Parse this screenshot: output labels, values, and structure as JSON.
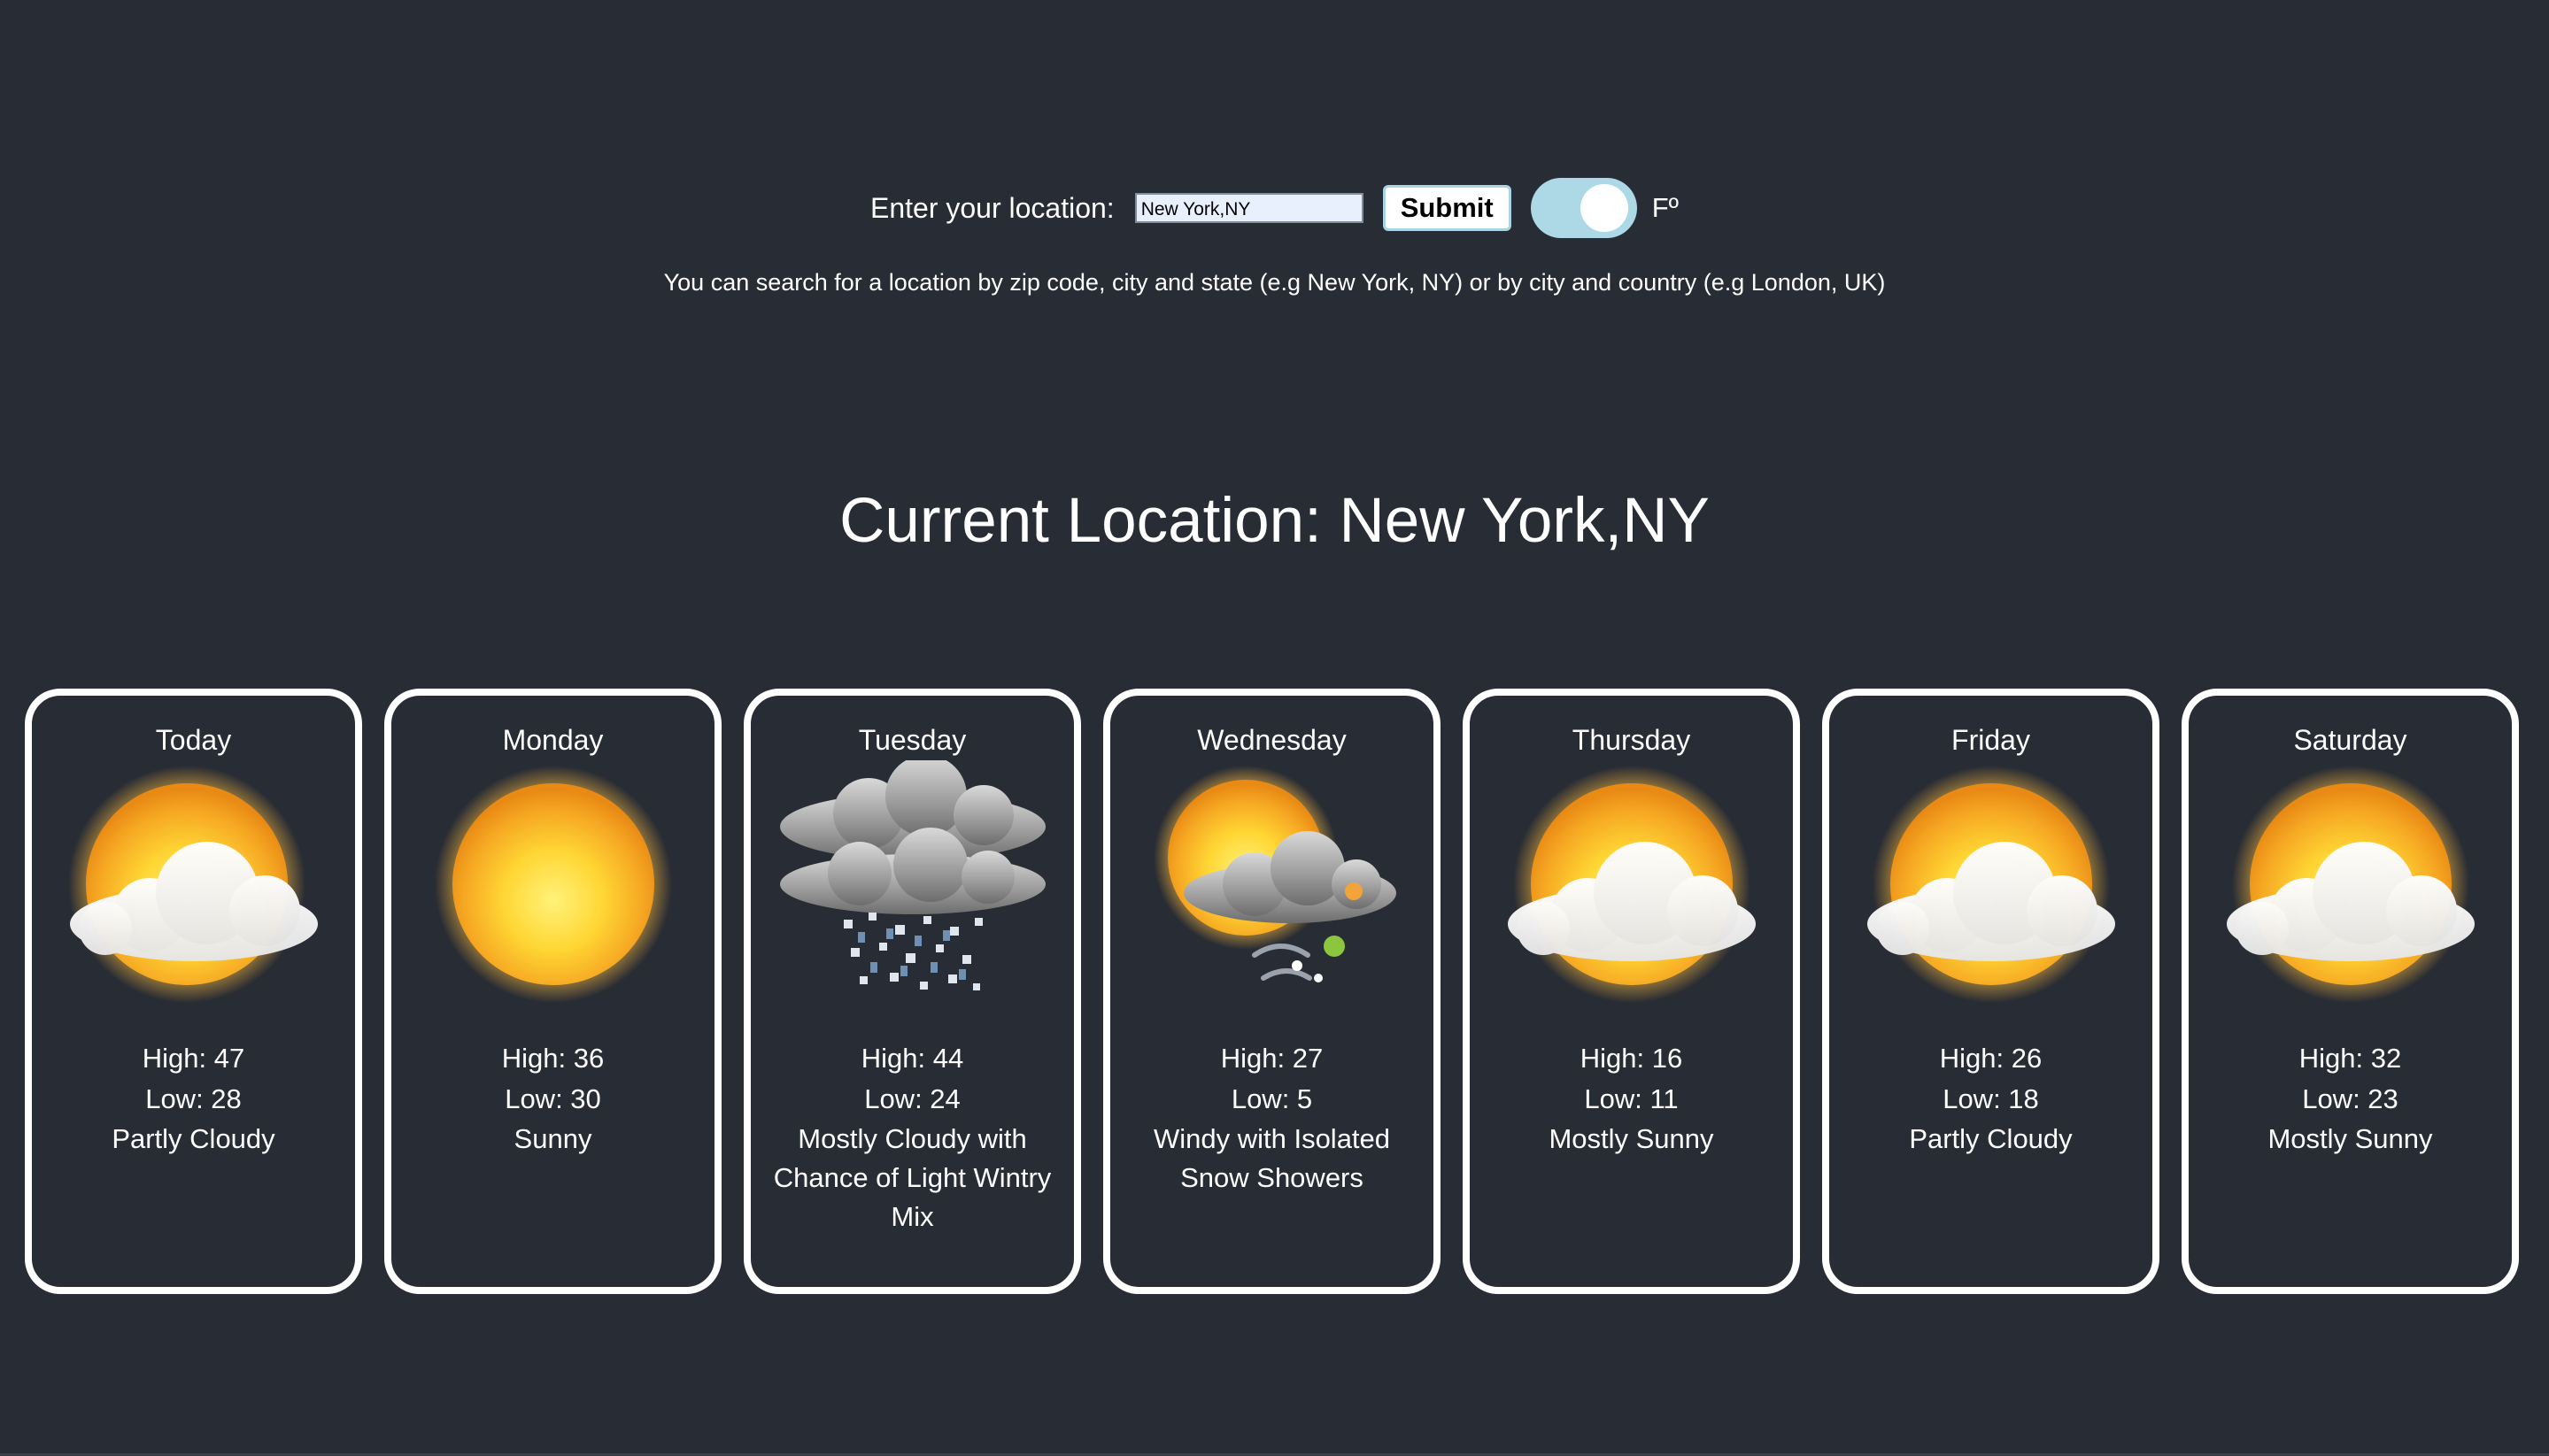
{
  "search": {
    "label": "Enter your location:",
    "value": "New York,NY",
    "submit_label": "Submit",
    "unit_label": "Fº"
  },
  "hint": "You can search for a location by zip code, city and state (e.g New York, NY) or by city and country (e.g London, UK)",
  "location_title": "Current Location: New York,NY",
  "forecast": [
    {
      "day": "Today",
      "high": "High: 47",
      "low": "Low: 28",
      "condition": "Partly Cloudy",
      "icon": "partly-cloudy-icon"
    },
    {
      "day": "Monday",
      "high": "High: 36",
      "low": "Low: 30",
      "condition": "Sunny",
      "icon": "sunny-icon"
    },
    {
      "day": "Tuesday",
      "high": "High: 44",
      "low": "Low: 24",
      "condition": "Mostly Cloudy with Chance of Light Wintry Mix",
      "icon": "wintry-mix-icon"
    },
    {
      "day": "Wednesday",
      "high": "High: 27",
      "low": "Low: 5",
      "condition": "Windy with Isolated Snow Showers",
      "icon": "windy-snow-icon"
    },
    {
      "day": "Thursday",
      "high": "High: 16",
      "low": "Low: 11",
      "condition": "Mostly Sunny",
      "icon": "partly-cloudy-icon"
    },
    {
      "day": "Friday",
      "high": "High: 26",
      "low": "Low: 18",
      "condition": "Partly Cloudy",
      "icon": "partly-cloudy-icon"
    },
    {
      "day": "Saturday",
      "high": "High: 32",
      "low": "Low: 23",
      "condition": "Mostly Sunny",
      "icon": "partly-cloudy-icon"
    }
  ],
  "colors": {
    "background": "#282c34",
    "toggle": "#add8e6",
    "card_border": "#ffffff"
  }
}
